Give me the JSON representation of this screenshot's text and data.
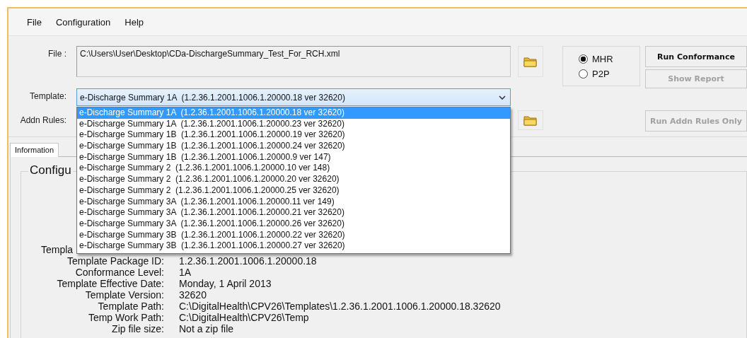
{
  "menu": [
    {
      "label": "File"
    },
    {
      "label": "Configuration"
    },
    {
      "label": "Help"
    }
  ],
  "file": {
    "label": "File :",
    "value": "C:\\Users\\User\\Desktop\\CDa-DischargeSummary_Test_For_RCH.xml"
  },
  "mode_options": [
    {
      "label": "MHR",
      "selected": true
    },
    {
      "label": "P2P",
      "selected": false
    }
  ],
  "buttons": [
    {
      "label": "Run Conformance",
      "disabled": false
    },
    {
      "label": "Show Report",
      "disabled": true
    }
  ],
  "template": {
    "label": "Template:",
    "value": "e-Discharge Summary 1A  (1.2.36.1.2001.1006.1.20000.18 ver 32620)",
    "expanded": true,
    "options": [
      {
        "label": "e-Discharge Summary 1A  (1.2.36.1.2001.1006.1.20000.18 ver 32620)",
        "selected": true
      },
      {
        "label": "e-Discharge Summary 1A  (1.2.36.1.2001.1006.1.20000.23 ver 32620)",
        "selected": false
      },
      {
        "label": "e-Discharge Summary 1B  (1.2.36.1.2001.1006.1.20000.19 ver 32620)",
        "selected": false
      },
      {
        "label": "e-Discharge Summary 1B  (1.2.36.1.2001.1006.1.20000.24 ver 32620)",
        "selected": false
      },
      {
        "label": "e-Discharge Summary 1B  (1.2.36.1.2001.1006.1.20000.9 ver 147)",
        "selected": false
      },
      {
        "label": "e-Discharge Summary 2  (1.2.36.1.2001.1006.1.20000.10 ver 148)",
        "selected": false
      },
      {
        "label": "e-Discharge Summary 2  (1.2.36.1.2001.1006.1.20000.20 ver 32620)",
        "selected": false
      },
      {
        "label": "e-Discharge Summary 2  (1.2.36.1.2001.1006.1.20000.25 ver 32620)",
        "selected": false
      },
      {
        "label": "e-Discharge Summary 3A  (1.2.36.1.2001.1006.1.20000.11 ver 149)",
        "selected": false
      },
      {
        "label": "e-Discharge Summary 3A  (1.2.36.1.2001.1006.1.20000.21 ver 32620)",
        "selected": false
      },
      {
        "label": "e-Discharge Summary 3A  (1.2.36.1.2001.1006.1.20000.26 ver 32620)",
        "selected": false
      },
      {
        "label": "e-Discharge Summary 3B  (1.2.36.1.2001.1006.1.20000.22 ver 32620)",
        "selected": false
      },
      {
        "label": "e-Discharge Summary 3B  (1.2.36.1.2001.1006.1.20000.27 ver 32620)",
        "selected": false
      }
    ]
  },
  "addn_rules": {
    "label": "Addn Rules:"
  },
  "run_addn_button": {
    "label": "Run Addn Rules Only",
    "disabled": true
  },
  "tabs": [
    {
      "label": "Information",
      "selected": true
    }
  ],
  "config_group": {
    "title": "Configu",
    "rows": [
      {
        "label": "Templa"
      },
      {
        "label": "Template Package ID:",
        "value": "1.2.36.1.2001.1006.1.20000.18"
      },
      {
        "label": "Conformance Level:",
        "value": "1A"
      },
      {
        "label": "Template Effective Date:",
        "value": "Monday, 1 April 2013"
      },
      {
        "label": "Template Version:",
        "value": "32620"
      },
      {
        "label": "Template Path:",
        "value": "C:\\DigitalHealth\\CPV26\\Templates\\1.2.36.1.2001.1006.1.20000.18.32620"
      },
      {
        "label": "Temp Work Path:",
        "value": "C:\\DigitalHealth\\CPV26\\Temp"
      },
      {
        "label": "Zip file size:",
        "value": "Not a zip file"
      }
    ]
  }
}
